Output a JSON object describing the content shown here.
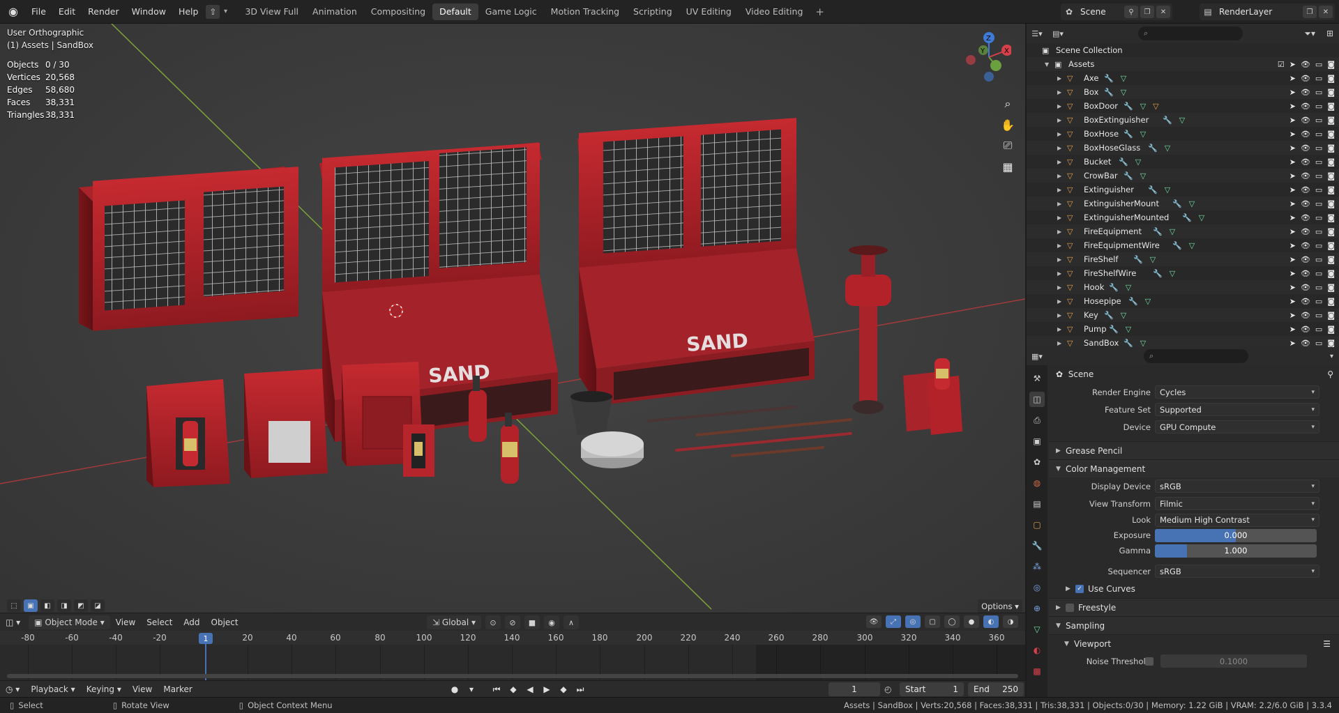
{
  "menu": [
    "File",
    "Edit",
    "Render",
    "Window",
    "Help"
  ],
  "workspaces": [
    "3D View Full",
    "Animation",
    "Compositing",
    "Default",
    "Game Logic",
    "Motion Tracking",
    "Scripting",
    "UV Editing",
    "Video Editing"
  ],
  "active_workspace": "Default",
  "scene": {
    "label": "Scene"
  },
  "render_layer": {
    "label": "RenderLayer"
  },
  "viewport": {
    "view_name": "User Orthographic",
    "collection": "(1) Assets | SandBox",
    "stats": [
      {
        "k": "Objects",
        "v": "0 / 30"
      },
      {
        "k": "Vertices",
        "v": "20,568"
      },
      {
        "k": "Edges",
        "v": "58,680"
      },
      {
        "k": "Faces",
        "v": "38,331"
      },
      {
        "k": "Triangles",
        "v": "38,331"
      }
    ],
    "sand_label_1": "SAND",
    "sand_label_2": "SAND",
    "options": "Options",
    "gizmo": {
      "x": "X",
      "y": "Y",
      "z": "Z"
    }
  },
  "viewport_header": {
    "mode": "Object Mode",
    "menus": [
      "View",
      "Select",
      "Add",
      "Object"
    ],
    "orientation": "Global"
  },
  "timeline": {
    "ticks": [
      "-80",
      "-60",
      "-40",
      "-20",
      "1",
      "20",
      "40",
      "60",
      "80",
      "100",
      "120",
      "140",
      "160",
      "180",
      "200",
      "220",
      "240",
      "260",
      "280",
      "300",
      "320",
      "340",
      "360"
    ],
    "current_frame": "1"
  },
  "playback_bar": {
    "menus": [
      "Playback",
      "Keying",
      "View",
      "Marker"
    ],
    "frame": "1",
    "start_label": "Start",
    "start": "1",
    "end_label": "End",
    "end": "250"
  },
  "statusbar": {
    "select": "Select",
    "rotate": "Rotate View",
    "context": "Object Context Menu",
    "info": "Assets | SandBox | Verts:20,568 | Faces:38,331 | Tris:38,331 | Objects:0/30 | Memory: 1.22 GiB | VRAM: 2.2/6.0 GiB | 3.3.4"
  },
  "outliner": {
    "root": "Scene Collection",
    "collection": "Assets",
    "items": [
      "Axe",
      "Box",
      "BoxDoor",
      "BoxExtinguisher",
      "BoxHose",
      "BoxHoseGlass",
      "Bucket",
      "CrowBar",
      "Extinguisher",
      "ExtinguisherMount",
      "ExtinguisherMounted",
      "FireEquipment",
      "FireEquipmentWire",
      "FireShelf",
      "FireShelfWire",
      "Hook",
      "Hosepipe",
      "Key",
      "Pump",
      "SandBox"
    ]
  },
  "properties": {
    "title": "Scene",
    "render_engine_label": "Render Engine",
    "render_engine": "Cycles",
    "feature_set_label": "Feature Set",
    "feature_set": "Supported",
    "device_label": "Device",
    "device": "GPU Compute",
    "grease_pencil": "Grease Pencil",
    "color_management": "Color Management",
    "display_device_label": "Display Device",
    "display_device": "sRGB",
    "view_transform_label": "View Transform",
    "view_transform": "Filmic",
    "look_label": "Look",
    "look": "Medium High Contrast",
    "exposure_label": "Exposure",
    "exposure": "0.000",
    "gamma_label": "Gamma",
    "gamma": "1.000",
    "sequencer_label": "Sequencer",
    "sequencer": "sRGB",
    "use_curves": "Use Curves",
    "freestyle": "Freestyle",
    "sampling": "Sampling",
    "viewport_sub": "Viewport",
    "noise_threshold_label": "Noise Threshold",
    "noise_threshold": "0.1000"
  },
  "colors": {
    "accent": "#4772b3",
    "asset_red": "#b0202a"
  }
}
